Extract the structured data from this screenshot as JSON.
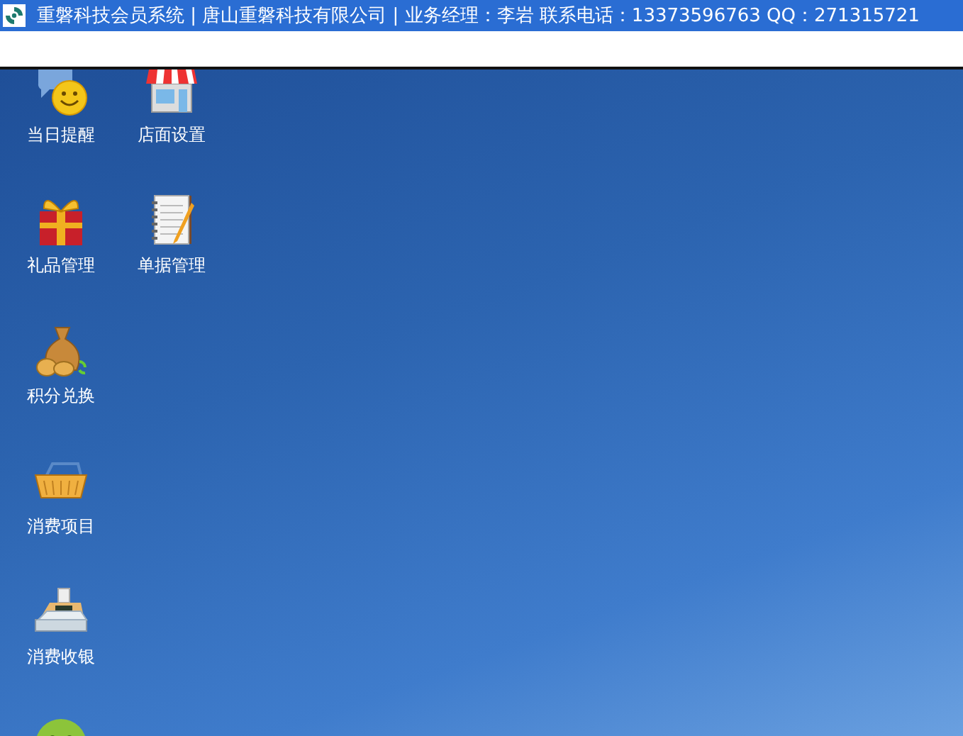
{
  "window": {
    "title": "重磐科技会员系统 | 唐山重磐科技有限公司 | 业务经理：李岩 联系电话：13373596763 QQ：271315721"
  },
  "desktop_icons": [
    {
      "kind": "reminder",
      "label": "当日提醒"
    },
    {
      "kind": "store",
      "label": "店面设置"
    },
    {
      "kind": "gift",
      "label": "礼品管理"
    },
    {
      "kind": "notepad",
      "label": "单据管理"
    },
    {
      "kind": "moneybag",
      "label": "积分兑换"
    },
    {
      "kind": "empty"
    },
    {
      "kind": "basket",
      "label": "消费项目"
    },
    {
      "kind": "empty"
    },
    {
      "kind": "register",
      "label": "消费收银"
    },
    {
      "kind": "empty"
    },
    {
      "kind": "smiley"
    }
  ]
}
